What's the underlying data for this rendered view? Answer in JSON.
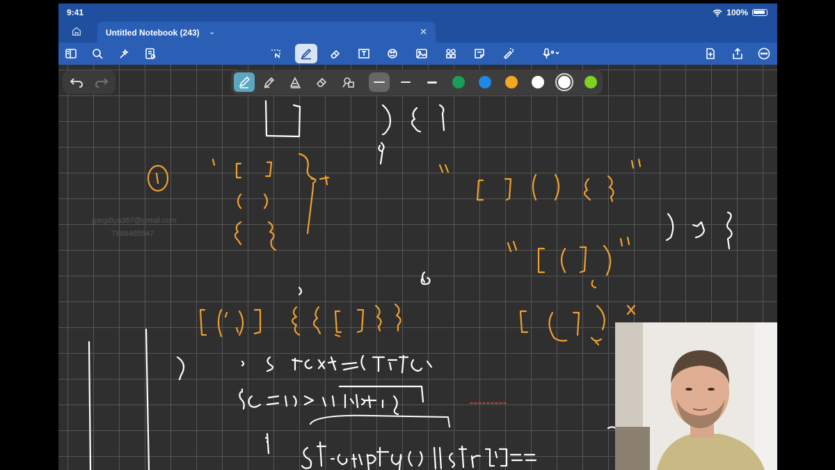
{
  "status_bar": {
    "time": "9:41",
    "battery": "100%"
  },
  "tab": {
    "title": "Untitled Notebook (243)"
  },
  "toolbar": {
    "left_icons": [
      "sidebar-icon",
      "search-icon",
      "sparkle-icon",
      "notes-icon"
    ],
    "center_icons": [
      "lasso-icon",
      "pen-icon",
      "eraser-icon",
      "textbox-icon",
      "shapes-icon",
      "image-icon",
      "elements-icon",
      "sticky-note-icon",
      "laser-pointer-icon",
      "microphone-icon"
    ],
    "right_icons": [
      "add-page-icon",
      "share-icon",
      "more-icon"
    ],
    "active_tool": "pen"
  },
  "pen_toolbar": {
    "tools": [
      "fountain-pen-icon",
      "ballpoint-pen-icon",
      "brush-pen-icon",
      "eraser-icon",
      "lasso-shapes-icon"
    ],
    "active_tool": "fountain-pen",
    "thickness_selected": 0,
    "colors": [
      "#1a9e5a",
      "#1e88e5",
      "#f5a623",
      "#ffffff",
      "#ffffff",
      "#7ed321"
    ],
    "selected_color_index": 4
  },
  "watermark": {
    "email": "gargdiya367@gmail.com",
    "phone": "7888465547"
  },
  "notes": {
    "item_number": "1",
    "example1": "\"[ ]  ( )  { }\"",
    "example1_display": "\"[ ] ( ) { }\"",
    "example2": "\"[ ( ] )\"",
    "example3": "[ ( ) ] { { [ ] } }",
    "closing": ") ] }",
    "code_line1": "stack<char> st;",
    "code_line2": "for(i = 0; i < n; i++)",
    "code_line3": "if( st.empty() || str[i] == '[' "
  }
}
